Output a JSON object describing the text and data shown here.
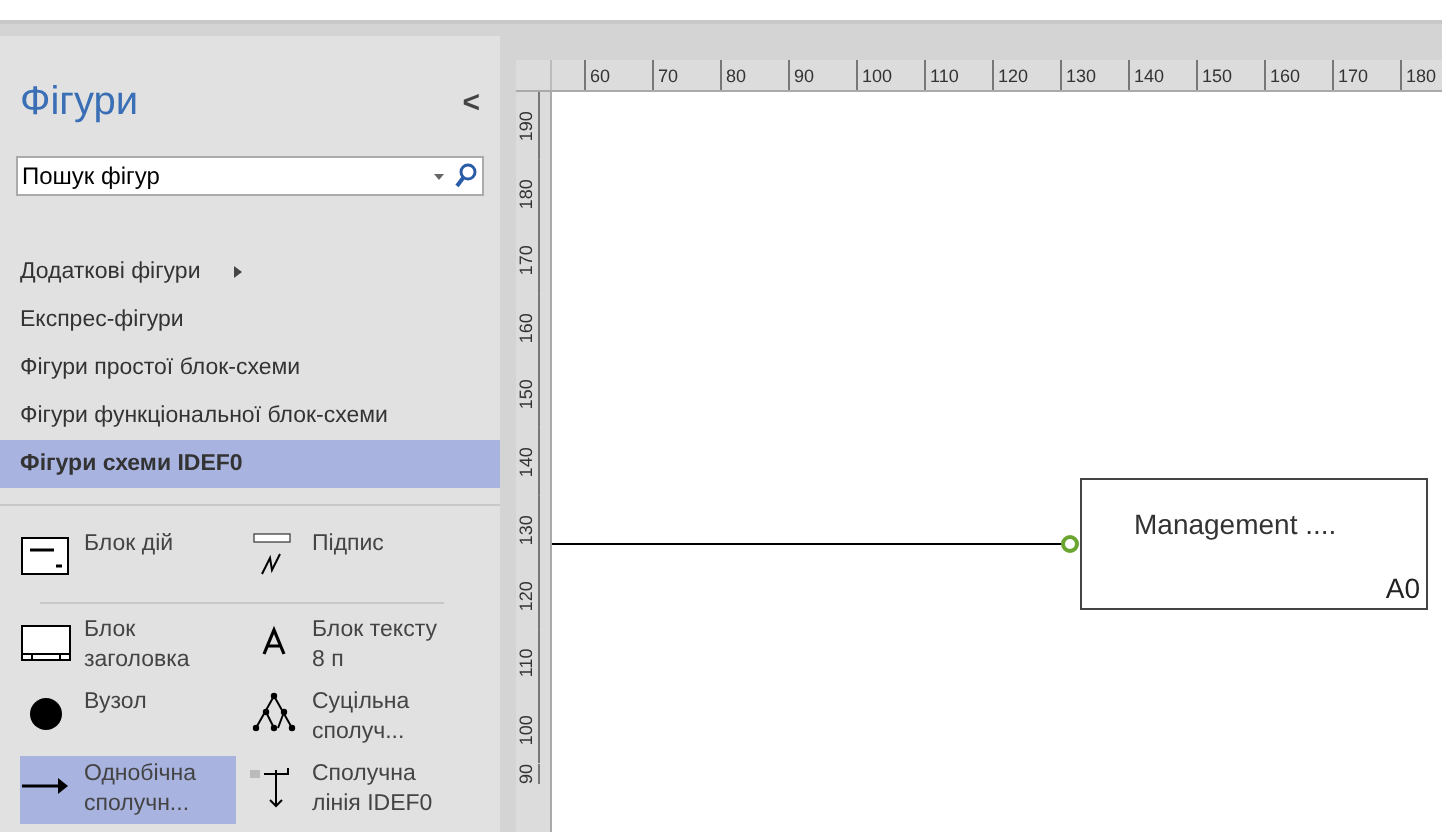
{
  "sidebar": {
    "title": "Фігури",
    "collapse": "<",
    "search": {
      "placeholder": "Пошук фігур"
    },
    "categories": [
      {
        "label": "Додаткові фігури",
        "submenu": true,
        "selected": false
      },
      {
        "label": "Експрес-фігури",
        "submenu": false,
        "selected": false
      },
      {
        "label": "Фігури простої блок-схеми",
        "submenu": false,
        "selected": false
      },
      {
        "label": "Фігури функціональної блок-схеми",
        "submenu": false,
        "selected": false
      },
      {
        "label": "Фігури схеми IDEF0",
        "submenu": false,
        "selected": true
      }
    ],
    "stencils": [
      {
        "kind": "activity",
        "label": "Блок дій",
        "selected": false
      },
      {
        "kind": "signature",
        "label": "Підпис",
        "selected": false
      },
      {
        "kind": "divider"
      },
      {
        "kind": "title",
        "label": "Блок заголовка",
        "selected": false
      },
      {
        "kind": "text",
        "label": "Блок тексту 8 п",
        "selected": false
      },
      {
        "kind": "node",
        "label": "Вузол",
        "selected": false
      },
      {
        "kind": "tree",
        "label": "Суцільна сполуч...",
        "selected": false
      },
      {
        "kind": "arrow",
        "label": "Однобічна сполучн...",
        "selected": true
      },
      {
        "kind": "idef",
        "label": "Сполучна лінія IDEF0",
        "selected": false
      }
    ]
  },
  "rulers": {
    "horizontal": [
      "60",
      "70",
      "80",
      "90",
      "100",
      "110",
      "120",
      "130",
      "140",
      "150",
      "160",
      "170",
      "180"
    ],
    "vertical": [
      "190",
      "180",
      "170",
      "160",
      "150",
      "140",
      "130",
      "120",
      "110",
      "100",
      "90"
    ]
  },
  "canvas": {
    "block": {
      "title": "Management ....",
      "number": "A0"
    }
  }
}
